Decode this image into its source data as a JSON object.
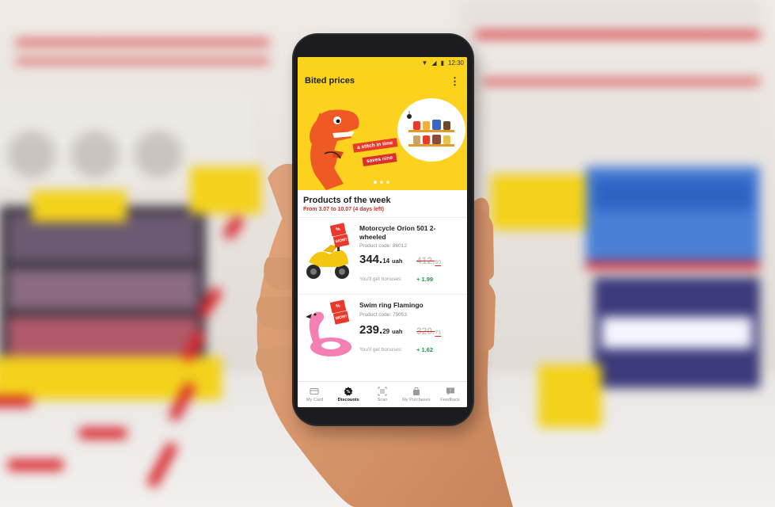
{
  "status": {
    "time": "12:30"
  },
  "app": {
    "title": "Bited prices",
    "menu_icon": "more-vertical-icon"
  },
  "banner": {
    "tag1": "a stitch in time",
    "tag2": "saves nine",
    "slides": 3,
    "active_slide": 1
  },
  "section": {
    "title": "Products of the week",
    "subtitle": "From 3.07 to 10.07 (4 days left)"
  },
  "products": [
    {
      "name": "Motorcycle Orion 501 2-wheeled",
      "code": "Product code: 86012",
      "price_main": "344.",
      "price_cents": "14",
      "currency": "uah",
      "old_price": "412.",
      "old_cents": "80",
      "bonus_label": "You'll get bonuses:",
      "bonus_value": "+ 1.99",
      "badge": "%\nWOW!"
    },
    {
      "name": "Swim ring Flamingo",
      "code": "Product code: 79053",
      "price_main": "239.",
      "price_cents": "29",
      "currency": "uah",
      "old_price": "320.",
      "old_cents": "71",
      "bonus_label": "You'll get bonuses:",
      "bonus_value": "+ 1.62",
      "badge": "%\nWOW!"
    }
  ],
  "tabs": [
    {
      "label": "My Card",
      "icon": "card-icon",
      "active": false
    },
    {
      "label": "Discounts",
      "icon": "discount-badge-icon",
      "active": true
    },
    {
      "label": "Scan",
      "icon": "barcode-scan-icon",
      "active": false
    },
    {
      "label": "My Purchases",
      "icon": "shopping-bag-icon",
      "active": false
    },
    {
      "label": "Feedback",
      "icon": "chat-bubble-icon",
      "active": false
    }
  ],
  "colors": {
    "accent": "#fbd31a",
    "red": "#e1251b",
    "green": "#1e9a3d"
  }
}
